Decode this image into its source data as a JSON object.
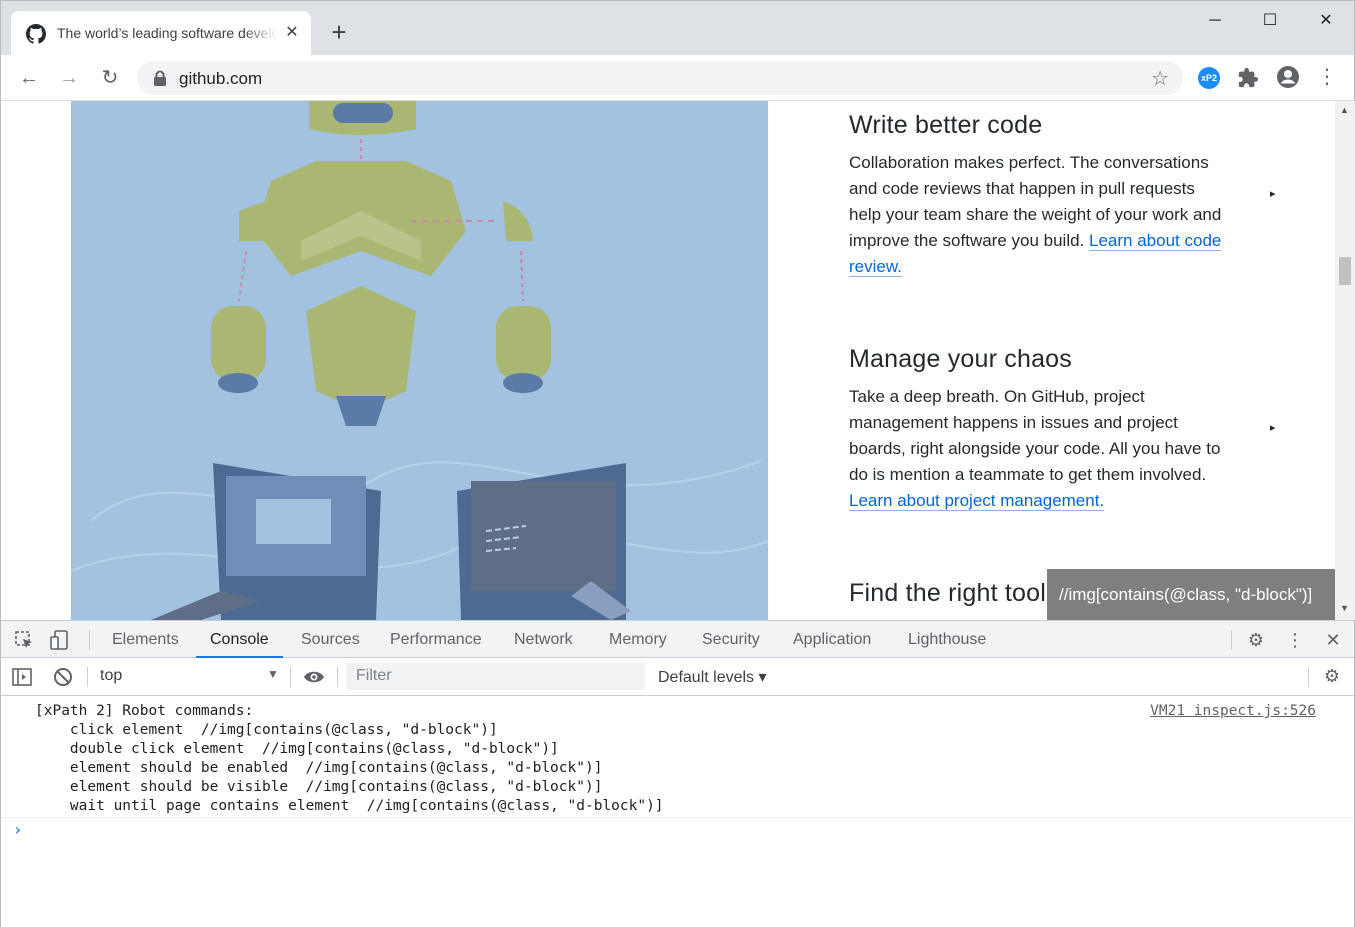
{
  "browser": {
    "tab": {
      "title": "The world’s leading software development platform · GitHub",
      "close": "✕"
    },
    "new_tab": "+",
    "window": {
      "minimize": "─",
      "maximize": "☐",
      "close": "✕"
    },
    "nav": {
      "back": "←",
      "forward": "→",
      "reload": "↻"
    },
    "url": "github.com",
    "extension_label": "xP2",
    "menu": "⋮"
  },
  "page": {
    "features": [
      {
        "heading": "Write better code",
        "text": "Collaboration makes perfect. The conversations and code reviews that happen in pull requests help your team share the weight of your work and improve the software you build. ",
        "link": "Learn about code review."
      },
      {
        "heading": "Manage your chaos",
        "text": "Take a deep breath. On GitHub, project management happens in issues and project boards, right alongside your code. All you have to do is mention a teammate to get them involved. ",
        "link": "Learn about project management."
      },
      {
        "heading": "Find the right tools",
        "text": "",
        "link": ""
      }
    ],
    "caret": "▸",
    "tooltip": "//img[contains(@class, \"d-block\")]"
  },
  "devtools": {
    "tabs": [
      "Elements",
      "Console",
      "Sources",
      "Performance",
      "Network",
      "Memory",
      "Security",
      "Application",
      "Lighthouse"
    ],
    "active_tab": "Console",
    "context": "top",
    "filter_placeholder": "Filter",
    "levels": "Default levels ▾",
    "console": {
      "message": "[xPath 2] Robot commands:\n    click element  //img[contains(@class, \"d-block\")]\n    double click element  //img[contains(@class, \"d-block\")]\n    element should be enabled  //img[contains(@class, \"d-block\")]\n    element should be visible  //img[contains(@class, \"d-block\")]\n    wait until page contains element  //img[contains(@class, \"d-block\")]",
      "source": "VM21 inspect.js:526",
      "prompt": "›"
    }
  },
  "colors": {
    "accent": "#1a73e8",
    "link": "#0366d6",
    "hero_bg": "#a3c2df"
  }
}
